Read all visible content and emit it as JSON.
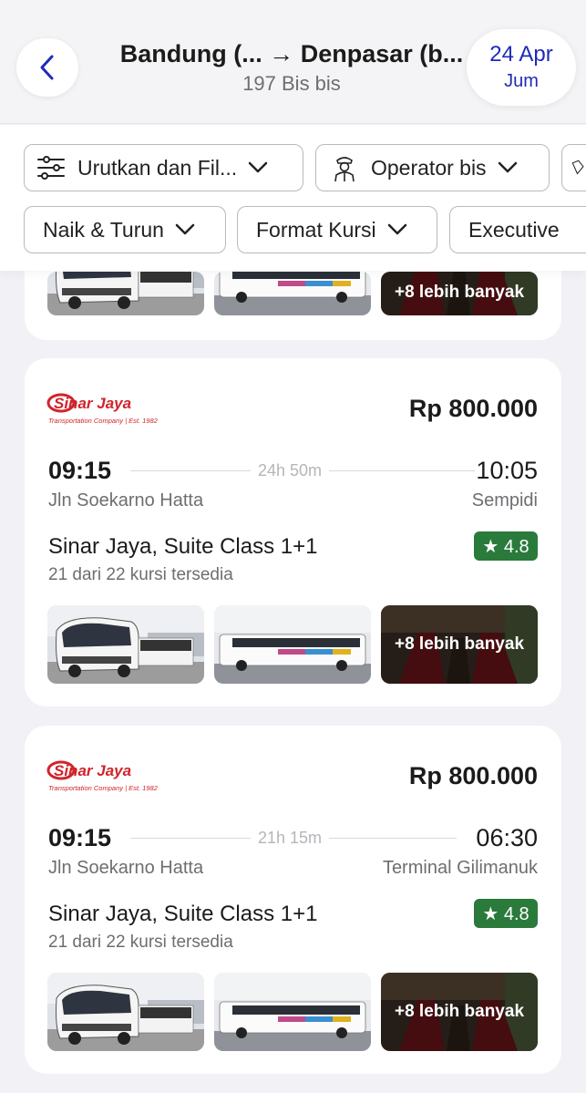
{
  "header": {
    "route": "Bandung (... → Denpasar (b...",
    "count": "197 Bis bis",
    "date": "24 Apr",
    "day": "Jum"
  },
  "filters": {
    "sort": "Urutkan dan Fil...",
    "operator": "Operator bis",
    "naik_turun": "Naik & Turun",
    "format_kursi": "Format Kursi",
    "executive": "Executive"
  },
  "colors": {
    "accent": "#1f2bb8",
    "rating_bg": "#2a7a3b",
    "logo_red": "#d0242b"
  },
  "cards": [
    {
      "more": "+8 lebih banyak"
    },
    {
      "price": "Rp 800.000",
      "dep_time": "09:15",
      "arr_time": "10:05",
      "duration": "24h 50m",
      "dep_place": "Jln Soekarno Hatta",
      "arr_place": "Sempidi",
      "name": "Sinar Jaya, Suite Class 1+1",
      "seats": "21 dari 22 kursi tersedia",
      "rating": "★ 4.8",
      "more": "+8 lebih banyak"
    },
    {
      "price": "Rp 800.000",
      "dep_time": "09:15",
      "arr_time": "06:30",
      "duration": "21h 15m",
      "dep_place": "Jln Soekarno Hatta",
      "arr_place": "Terminal Gilimanuk",
      "name": "Sinar Jaya, Suite Class 1+1",
      "seats": "21 dari 22 kursi tersedia",
      "rating": "★ 4.8",
      "more": "+8 lebih banyak"
    }
  ],
  "logo": {
    "brand": "Sinar Jaya",
    "tagline": "Transportation Company | Est. 1982"
  }
}
